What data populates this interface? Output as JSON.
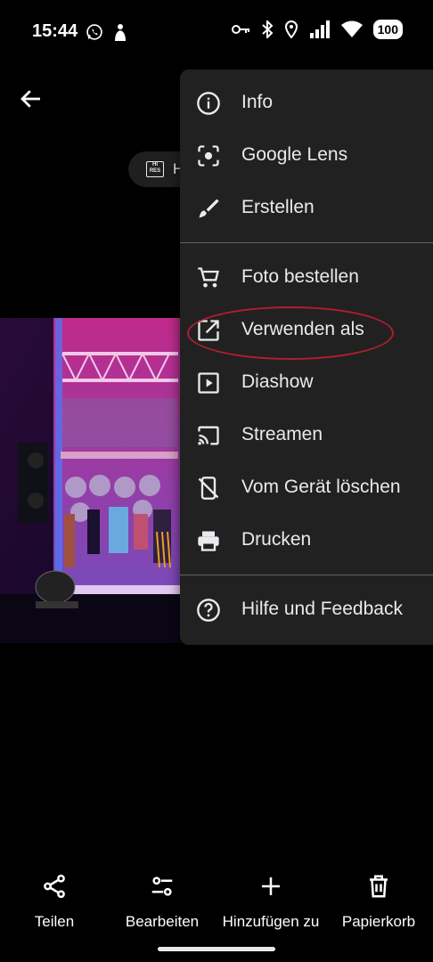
{
  "status_bar": {
    "time": "15:44",
    "battery": "100",
    "icons": [
      "whatsapp-icon",
      "notification-icon",
      "vpn-key-icon",
      "bluetooth-icon",
      "location-icon",
      "signal-icon",
      "wifi-icon",
      "battery-icon"
    ]
  },
  "chip": {
    "badge": "HI RES",
    "text": "H"
  },
  "menu": {
    "items": [
      {
        "label": "Info",
        "icon": "info-icon"
      },
      {
        "label": "Google Lens",
        "icon": "lens-icon"
      },
      {
        "label": "Erstellen",
        "icon": "brush-icon"
      },
      {
        "label": "Foto bestellen",
        "icon": "cart-icon"
      },
      {
        "label": "Verwenden als",
        "icon": "open-in-new-icon"
      },
      {
        "label": "Diashow",
        "icon": "slideshow-icon"
      },
      {
        "label": "Streamen",
        "icon": "cast-icon"
      },
      {
        "label": "Vom Gerät löschen",
        "icon": "phone-delete-icon"
      },
      {
        "label": "Drucken",
        "icon": "print-icon"
      },
      {
        "label": "Hilfe und Feedback",
        "icon": "help-icon"
      }
    ],
    "highlighted": "Verwenden als",
    "highlight_color": "#b01e2e"
  },
  "bottom_bar": {
    "share": "Teilen",
    "edit": "Bearbeiten",
    "add": "Hinzufügen zu",
    "trash": "Papierkorb"
  }
}
